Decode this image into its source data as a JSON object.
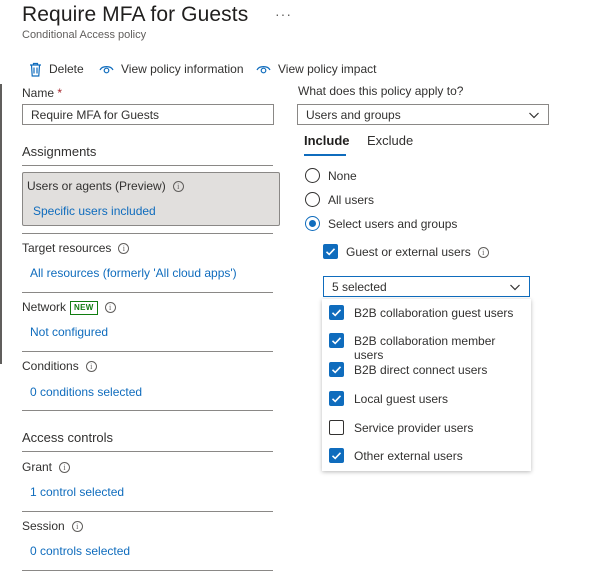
{
  "header": {
    "title": "Require MFA for Guests",
    "subtitle": "Conditional Access policy",
    "more_label": "···"
  },
  "toolbar": {
    "delete_label": "Delete",
    "view_info_label": "View policy information",
    "view_impact_label": "View policy impact"
  },
  "name_field": {
    "label": "Name",
    "required_mark": "*",
    "value": "Require MFA for Guests"
  },
  "assignments": {
    "heading": "Assignments",
    "users": {
      "label": "Users or agents (Preview)",
      "link": "Specific users included"
    },
    "target_resources": {
      "label": "Target resources",
      "link": "All resources (formerly 'All cloud apps')"
    },
    "network": {
      "label": "Network",
      "badge": "NEW",
      "link": "Not configured"
    },
    "conditions": {
      "label": "Conditions",
      "link": "0 conditions selected"
    }
  },
  "access_controls": {
    "heading": "Access controls",
    "grant": {
      "label": "Grant",
      "link": "1 control selected"
    },
    "session": {
      "label": "Session",
      "link": "0 controls selected"
    }
  },
  "right_panel": {
    "question": "What does this policy apply to?",
    "apply_to_value": "Users and groups",
    "tabs": {
      "include": "Include",
      "exclude": "Exclude",
      "active": "include"
    },
    "radios": [
      {
        "label": "None",
        "checked": false
      },
      {
        "label": "All users",
        "checked": false
      },
      {
        "label": "Select users and groups",
        "checked": true
      }
    ],
    "guest_checkbox": {
      "label": "Guest or external users",
      "checked": true
    },
    "guest_types_dropdown": {
      "value": "5 selected",
      "options": [
        {
          "label": "B2B collaboration guest users",
          "checked": true
        },
        {
          "label": "B2B collaboration member users",
          "checked": true
        },
        {
          "label": "B2B direct connect users",
          "checked": true
        },
        {
          "label": "Local guest users",
          "checked": true
        },
        {
          "label": "Service provider users",
          "checked": false
        },
        {
          "label": "Other external users",
          "checked": true
        }
      ]
    }
  },
  "colors": {
    "accent": "#0f6cbd",
    "new_badge": "#107c10",
    "required": "#a4262c",
    "selected_row_bg": "#e1dfdd"
  },
  "icons": {
    "delete": "trash-icon",
    "view_info": "eye-icon",
    "view_impact": "eye-icon",
    "info": "info-icon",
    "dropdown": "chevron-down-icon",
    "check": "checkmark-icon"
  }
}
